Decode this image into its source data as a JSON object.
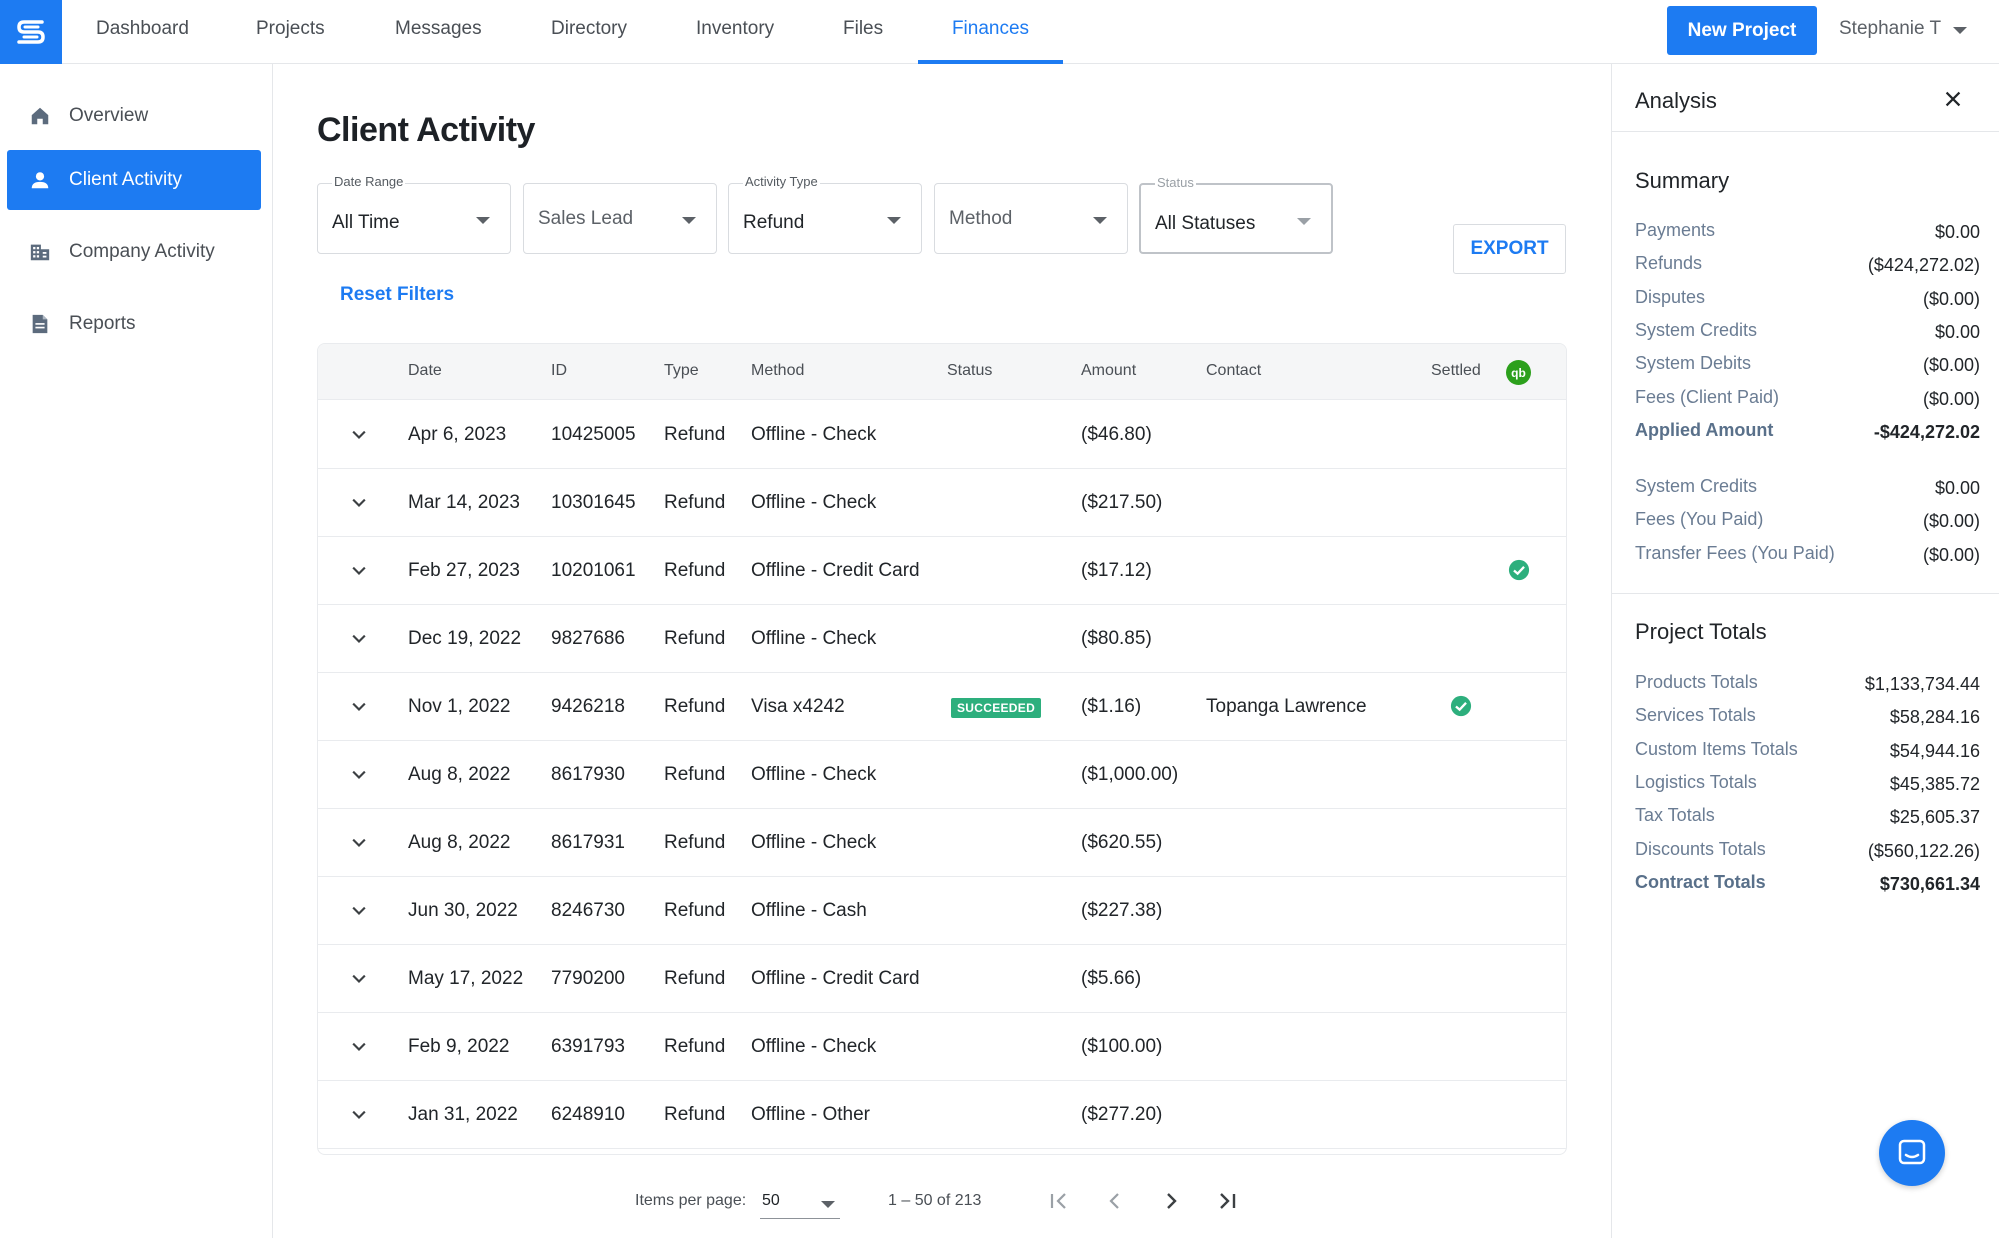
{
  "nav": {
    "tabs": [
      {
        "label": "Dashboard"
      },
      {
        "label": "Projects"
      },
      {
        "label": "Messages"
      },
      {
        "label": "Directory"
      },
      {
        "label": "Inventory"
      },
      {
        "label": "Files"
      },
      {
        "label": "Finances"
      }
    ],
    "active_tab": "Finances",
    "new_project_label": "New Project",
    "user_name": "Stephanie T"
  },
  "sidebar": {
    "items": [
      {
        "label": "Overview",
        "icon": "home-icon"
      },
      {
        "label": "Client Activity",
        "icon": "person-icon"
      },
      {
        "label": "Company Activity",
        "icon": "building-icon"
      },
      {
        "label": "Reports",
        "icon": "report-icon"
      }
    ],
    "active_item": "Client Activity"
  },
  "main": {
    "title": "Client Activity",
    "filters": {
      "date_range": {
        "label": "Date Range",
        "value": "All Time"
      },
      "sales_lead": {
        "placeholder": "Sales Lead"
      },
      "activity_type": {
        "label": "Activity Type",
        "value": "Refund"
      },
      "method": {
        "placeholder": "Method"
      },
      "status": {
        "label": "Status",
        "value": "All Statuses"
      }
    },
    "export_label": "EXPORT",
    "reset_label": "Reset Filters"
  },
  "table": {
    "columns": {
      "date": "Date",
      "id": "ID",
      "type": "Type",
      "method": "Method",
      "status": "Status",
      "amount": "Amount",
      "contact": "Contact",
      "settled": "Settled"
    },
    "quickbooks_badge": "qb",
    "rows": [
      {
        "date": "Apr 6, 2023",
        "id": "10425005",
        "type": "Refund",
        "method": "Offline - Check",
        "status": "",
        "amount": "($46.80)",
        "contact": "",
        "settled": false
      },
      {
        "date": "Mar 14, 2023",
        "id": "10301645",
        "type": "Refund",
        "method": "Offline - Check",
        "status": "",
        "amount": "($217.50)",
        "contact": "",
        "settled": false
      },
      {
        "date": "Feb 27, 2023",
        "id": "10201061",
        "type": "Refund",
        "method": "Offline - Credit Card",
        "status": "",
        "amount": "($17.12)",
        "contact": "",
        "settled": true
      },
      {
        "date": "Dec 19, 2022",
        "id": "9827686",
        "type": "Refund",
        "method": "Offline - Check",
        "status": "",
        "amount": "($80.85)",
        "contact": "",
        "settled": false
      },
      {
        "date": "Nov 1, 2022",
        "id": "9426218",
        "type": "Refund",
        "method": "Visa x4242",
        "status": "SUCCEEDED",
        "amount": "($1.16)",
        "contact": "Topanga Lawrence",
        "settled": true
      },
      {
        "date": "Aug 8, 2022",
        "id": "8617930",
        "type": "Refund",
        "method": "Offline - Check",
        "status": "",
        "amount": "($1,000.00)",
        "contact": "",
        "settled": false
      },
      {
        "date": "Aug 8, 2022",
        "id": "8617931",
        "type": "Refund",
        "method": "Offline - Check",
        "status": "",
        "amount": "($620.55)",
        "contact": "",
        "settled": false
      },
      {
        "date": "Jun 30, 2022",
        "id": "8246730",
        "type": "Refund",
        "method": "Offline - Cash",
        "status": "",
        "amount": "($227.38)",
        "contact": "",
        "settled": false
      },
      {
        "date": "May 17, 2022",
        "id": "7790200",
        "type": "Refund",
        "method": "Offline - Credit Card",
        "status": "",
        "amount": "($5.66)",
        "contact": "",
        "settled": false
      },
      {
        "date": "Feb 9, 2022",
        "id": "6391793",
        "type": "Refund",
        "method": "Offline - Check",
        "status": "",
        "amount": "($100.00)",
        "contact": "",
        "settled": false
      },
      {
        "date": "Jan 31, 2022",
        "id": "6248910",
        "type": "Refund",
        "method": "Offline - Other",
        "status": "",
        "amount": "($277.20)",
        "contact": "",
        "settled": false
      }
    ]
  },
  "pagination": {
    "items_per_page_label": "Items per page:",
    "items_per_page": "50",
    "range": "1 – 50 of 213"
  },
  "analysis": {
    "title": "Analysis",
    "summary_title": "Summary",
    "summary": [
      {
        "label": "Payments",
        "value": "$0.00",
        "bold": false
      },
      {
        "label": "Refunds",
        "value": "($424,272.02)",
        "bold": false
      },
      {
        "label": "Disputes",
        "value": "($0.00)",
        "bold": false
      },
      {
        "label": "System Credits",
        "value": "$0.00",
        "bold": false
      },
      {
        "label": "System Debits",
        "value": "($0.00)",
        "bold": false
      },
      {
        "label": "Fees (Client Paid)",
        "value": "($0.00)",
        "bold": false
      },
      {
        "label": "Applied Amount",
        "value": "-$424,272.02",
        "bold": true
      }
    ],
    "summary_extra": [
      {
        "label": "System Credits",
        "value": "$0.00"
      },
      {
        "label": "Fees (You Paid)",
        "value": "($0.00)"
      },
      {
        "label": "Transfer Fees (You Paid)",
        "value": "($0.00)"
      }
    ],
    "project_totals_title": "Project Totals",
    "project_totals": [
      {
        "label": "Products Totals",
        "value": "$1,133,734.44",
        "bold": false
      },
      {
        "label": "Services Totals",
        "value": "$58,284.16",
        "bold": false
      },
      {
        "label": "Custom Items Totals",
        "value": "$54,944.16",
        "bold": false
      },
      {
        "label": "Logistics Totals",
        "value": "$45,385.72",
        "bold": false
      },
      {
        "label": "Tax Totals",
        "value": "$25,605.37",
        "bold": false
      },
      {
        "label": "Discounts Totals",
        "value": "($560,122.26)",
        "bold": false
      },
      {
        "label": "Contract Totals",
        "value": "$730,661.34",
        "bold": true
      }
    ]
  },
  "colors": {
    "accent": "#1d7bf2",
    "success": "#2daf7d",
    "quickbooks": "#2ca01c"
  }
}
